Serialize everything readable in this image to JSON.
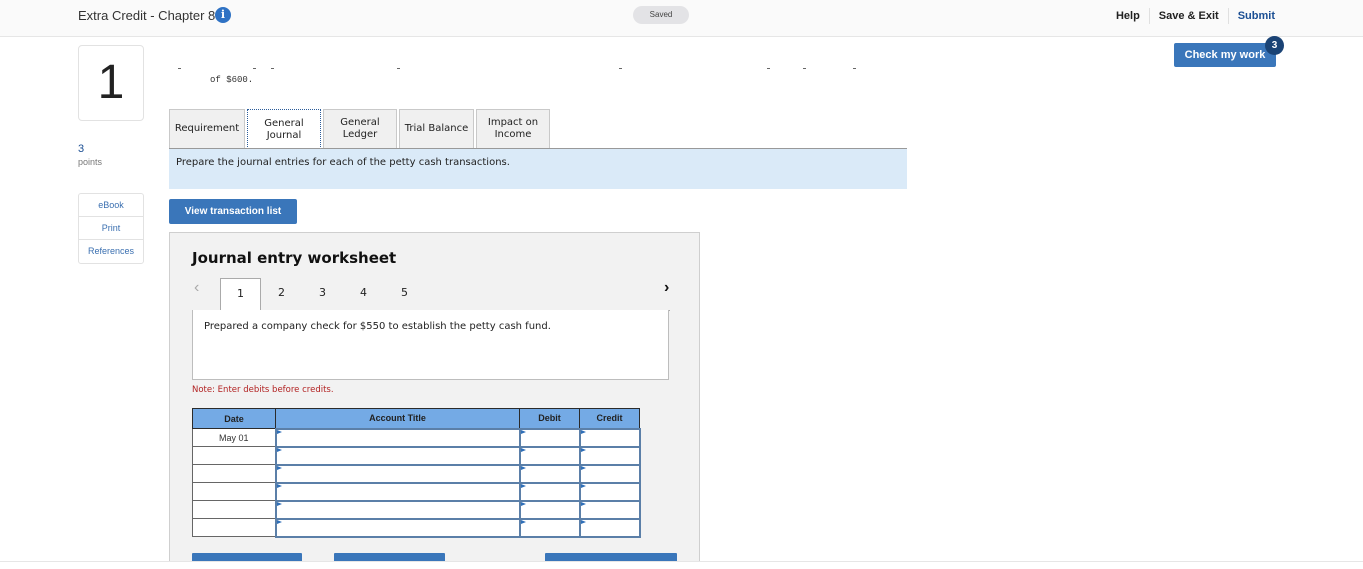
{
  "header": {
    "title": "Extra Credit - Chapter 8",
    "info_icon": "info-icon",
    "save_status": "Saved",
    "links": {
      "help": "Help",
      "save_exit": "Save & Exit",
      "submit": "Submit"
    },
    "check_work": {
      "label": "Check my work",
      "badge": "3"
    }
  },
  "question": {
    "number": "1",
    "points_value": "3",
    "points_label": "points",
    "side_links": [
      "eBook",
      "Print",
      "References"
    ],
    "partial_text": "of $600."
  },
  "tabs": [
    {
      "label": "Requirement",
      "active": false
    },
    {
      "label": "General Journal",
      "active": true
    },
    {
      "label": "General Ledger",
      "active": false
    },
    {
      "label": "Trial Balance",
      "active": false
    },
    {
      "label": "Impact on Income",
      "active": false
    }
  ],
  "instruction": "Prepare the journal entries for each of the petty cash transactions.",
  "view_transaction_label": "View transaction list",
  "worksheet": {
    "title": "Journal entry worksheet",
    "prev_icon": "chevron-left-icon",
    "next_icon": "chevron-right-icon",
    "entry_tabs": [
      "1",
      "2",
      "3",
      "4",
      "5"
    ],
    "active_entry": "1",
    "description": "Prepared a company check for $550 to establish the petty cash fund.",
    "note": "Note: Enter debits before credits.",
    "table": {
      "headers": {
        "date": "Date",
        "account": "Account Title",
        "debit": "Debit",
        "credit": "Credit"
      },
      "rows": [
        {
          "date": "May 01",
          "account": "",
          "debit": "",
          "credit": ""
        },
        {
          "date": "",
          "account": "",
          "debit": "",
          "credit": ""
        },
        {
          "date": "",
          "account": "",
          "debit": "",
          "credit": ""
        },
        {
          "date": "",
          "account": "",
          "debit": "",
          "credit": ""
        },
        {
          "date": "",
          "account": "",
          "debit": "",
          "credit": ""
        },
        {
          "date": "",
          "account": "",
          "debit": "",
          "credit": ""
        }
      ]
    }
  },
  "colors": {
    "primary_button": "#3a76ba",
    "submit_link": "#1a4e93",
    "instruction_bg": "#daeaf8",
    "table_header": "#74aae5",
    "note_text": "#b22222"
  }
}
